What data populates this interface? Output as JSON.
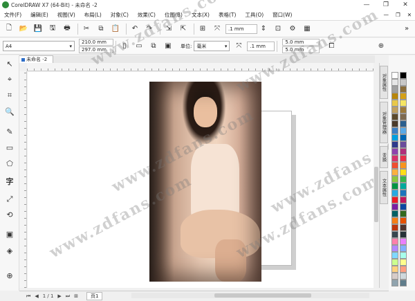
{
  "window": {
    "title": "CorelDRAW X7 (64-Bit) - 未命名 -2",
    "minimize": "—",
    "maximize": "❐",
    "close": "✕"
  },
  "menu": {
    "items": [
      "文件(F)",
      "编辑(E)",
      "视图(V)",
      "布局(L)",
      "对象(C)",
      "效果(C)",
      "位图(B)",
      "文本(X)",
      "表格(T)",
      "工具(O)",
      "窗口(W)"
    ],
    "extra": [
      "—",
      "❐",
      "✕"
    ]
  },
  "toolbar1": {
    "nudge_value": ".1 mm"
  },
  "toolbar2": {
    "page_size": "A4",
    "width": "210.0 mm",
    "height": "297.0 mm",
    "units_label": "单位:",
    "units_value": "毫米",
    "nudge_value": ".1 mm",
    "dup_x": "5.0 mm",
    "dup_y": "5.0 mm"
  },
  "document_tab": {
    "label": "未命名 -2"
  },
  "dockers": [
    "对象属性",
    "对象管理器",
    "变换",
    "文本属性"
  ],
  "status": {
    "page_indicator": "1 / 1",
    "page_tab": "页1"
  },
  "palette": {
    "colors": [
      "#ffffff",
      "#000000",
      "#e6e6e6",
      "#c8c8c8",
      "#a0a0a0",
      "#8a6d3b",
      "#b8860b",
      "#d4a017",
      "#e8c84a",
      "#f5e663",
      "#c0a060",
      "#9c7a3c",
      "#5c4a2c",
      "#7e6a50",
      "#4a3a2a",
      "#2b5f8e",
      "#3b7fc4",
      "#5aa9e6",
      "#00a0e0",
      "#0066b3",
      "#2e3a8c",
      "#6a4c9c",
      "#8e44ad",
      "#b0307a",
      "#d6336c",
      "#e8314a",
      "#f04e30",
      "#f7941d",
      "#fbb040",
      "#ffde17",
      "#8dc63f",
      "#39b54a",
      "#009444",
      "#00a99d",
      "#27aae1",
      "#1c75bc",
      "#ed1c24",
      "#c2185b",
      "#7b1fa2",
      "#0d47a1",
      "#006064",
      "#33691e",
      "#f57f17",
      "#e65100",
      "#bf360c",
      "#4e342e",
      "#37474f",
      "#263238",
      "#ff80ab",
      "#ea80fc",
      "#b388ff",
      "#82b1ff",
      "#80d8ff",
      "#a7ffeb",
      "#ccff90",
      "#ffff8d",
      "#ffd180",
      "#ff9e80",
      "#d7ccc8",
      "#cfd8dc",
      "#90a4ae",
      "#607d8b"
    ]
  },
  "watermark": "www.zdfans.com"
}
